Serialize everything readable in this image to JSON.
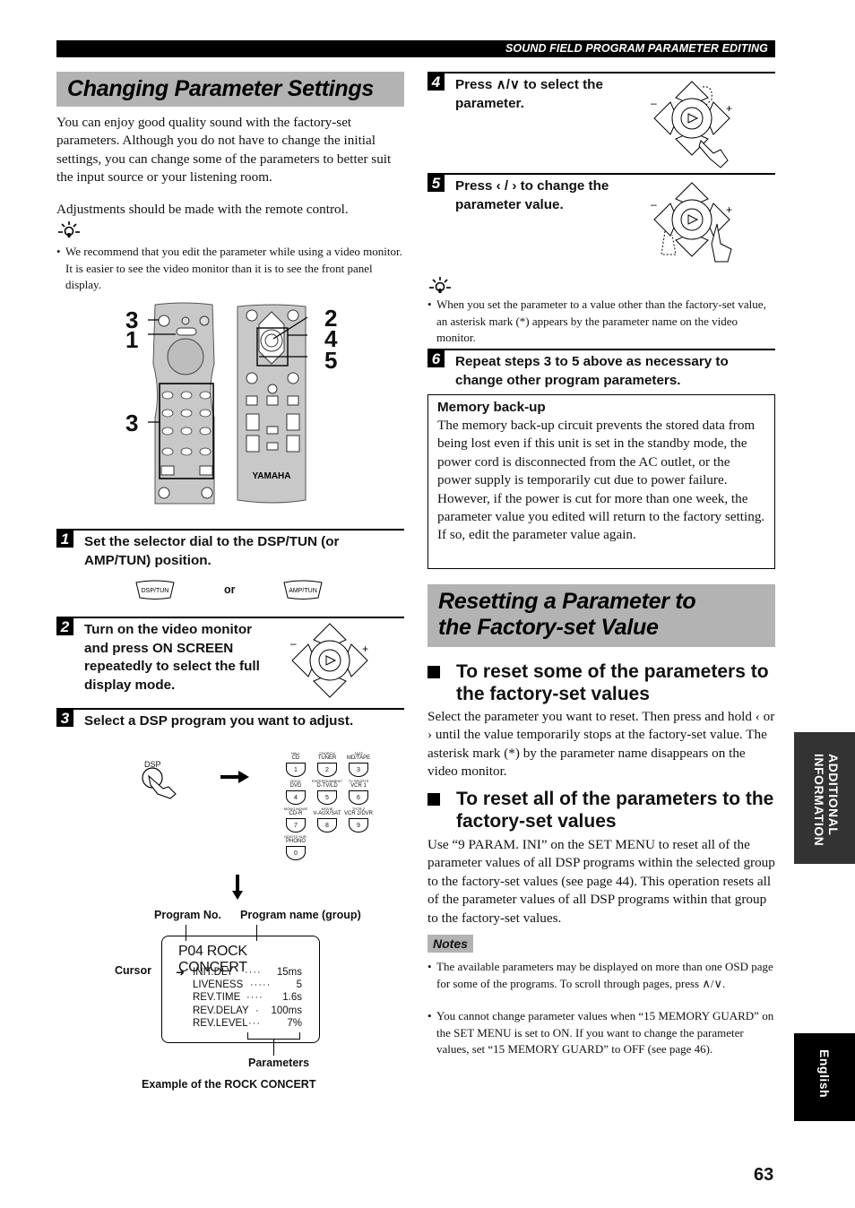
{
  "header": {
    "section_title": "SOUND FIELD PROGRAM PARAMETER EDITING"
  },
  "left": {
    "title": "Changing Parameter Settings",
    "intro": "You can enjoy good quality sound with the factory-set parameters. Although you do not have to change the initial settings, you can change some of the parameters to better suit the input source or your listening room.",
    "remote_note": "Adjustments should be made with the remote control.",
    "tip_bullet": "We recommend that you edit the parameter while using a video monitor. It is easier to see the video monitor than it is to see the front panel display.",
    "remote_callouts": {
      "left": [
        "3",
        "1",
        "3"
      ],
      "right": [
        "2",
        "4",
        "5"
      ]
    },
    "remote_brand": "YAMAHA",
    "steps": [
      {
        "num": "1",
        "text": "Set the selector dial to the DSP/TUN (or AMP/TUN) position."
      },
      {
        "num": "2",
        "text": "Turn on the video monitor and press ON SCREEN repeatedly to select the full display mode."
      },
      {
        "num": "3",
        "text": "Select a DSP program you want to adjust."
      }
    ],
    "selector": {
      "option_a": "DSP/TUN",
      "or": "or",
      "option_b": "AMP/TUN"
    },
    "dsp_button_label": "DSP",
    "keypad": [
      {
        "top": "HALL",
        "main": "CD",
        "key": "1"
      },
      {
        "top": "CHURCH",
        "main": "TUNER",
        "key": "2"
      },
      {
        "top": "JAZZ",
        "main": "MD/TAPE",
        "key": "3"
      },
      {
        "top": "ROCK",
        "main": "DVD",
        "key": "4"
      },
      {
        "top": "ENTERTAINMENT",
        "main": "D-TV/LD",
        "key": "5"
      },
      {
        "top": "TV SPORTS",
        "main": "VCR 1",
        "key": "6"
      },
      {
        "top": "MONO MOVIE",
        "main": "CD-R",
        "key": "7"
      },
      {
        "top": "MOVIE",
        "main": "V-AUX/SAT",
        "key": "8"
      },
      {
        "top": "THTR-2",
        "main": "VCR 2/DVR",
        "key": "9"
      },
      {
        "top": "DD/DTS SUR.",
        "main": "PHONO",
        "key": "0"
      }
    ],
    "osd_example": {
      "label_program_no": "Program No.",
      "label_program_name": "Program name (group)",
      "label_cursor": "Cursor",
      "label_parameters": "Parameters",
      "caption": "Example of the ROCK CONCERT",
      "title": "P04 ROCK CONCERT",
      "cursor_glyph": "➜",
      "rows": [
        {
          "name": "INIT.DLY",
          "dots": "····",
          "value": "15ms"
        },
        {
          "name": "LIVENESS",
          "dots": "·····",
          "value": "5"
        },
        {
          "name": "REV.TIME",
          "dots": "····",
          "value": "1.6s"
        },
        {
          "name": "REV.DELAY",
          "dots": "·",
          "value": "100ms"
        },
        {
          "name": "REV.LEVEL",
          "dots": "···",
          "value": "7%"
        }
      ]
    }
  },
  "right": {
    "steps": [
      {
        "num": "4",
        "text": "Press ∧/∨ to select the parameter."
      },
      {
        "num": "5",
        "text": "Press ‹ / › to change the parameter value."
      },
      {
        "num": "6",
        "text": "Repeat steps 3 to 5 above as necessary to change other program parameters."
      }
    ],
    "tip_bullet": "When you set the parameter to a value other than the factory-set value, an asterisk mark (*) appears by the parameter name on the video monitor.",
    "memory_box": {
      "heading": "Memory back-up",
      "body": "The memory back-up circuit prevents the stored data from being lost even if this unit is set in the standby mode, the power cord is disconnected from the AC outlet, or the power supply is temporarily cut due to power failure. However, if the power is cut for more than one week, the parameter value you edited will return to the factory setting. If so, edit the parameter value again."
    },
    "title": "Resetting a Parameter to the Factory-set Value",
    "subsections": [
      {
        "heading": "To reset some of the parameters to the factory-set values",
        "body": "Select the parameter you want to reset. Then press and hold ‹ or › until the value temporarily stops at the factory-set value. The asterisk mark (*) by the parameter name disappears on the video monitor."
      },
      {
        "heading": "To reset all of the parameters to the factory-set values",
        "body": "Use “9 PARAM. INI” on the SET MENU to reset all of the parameter values of all DSP programs within the selected group to the factory-set values (see page 44). This operation resets all of the parameter values of all DSP programs within that group to the factory-set values."
      }
    ],
    "notes_label": "Notes",
    "notes": [
      "The available parameters may be displayed on more than one OSD page for some of the programs. To scroll through pages, press ∧/∨.",
      "You cannot change parameter values when “15 MEMORY GUARD” on the SET MENU is set to ON. If you want to change the parameter values, set “15 MEMORY GUARD” to OFF (see page 46)."
    ]
  },
  "side_tabs": {
    "section": "ADDITIONAL INFORMATION",
    "language": "English"
  },
  "page_number": "63"
}
